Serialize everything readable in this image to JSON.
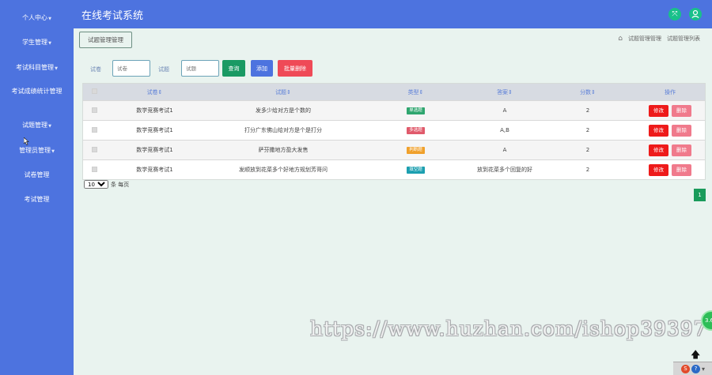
{
  "app": {
    "title": "在线考试系统"
  },
  "sidebar": {
    "items": [
      {
        "label": "个人中心",
        "caret": true
      },
      {
        "label": "学生管理",
        "caret": true
      },
      {
        "label": "考试科目管理",
        "caret": true
      },
      {
        "label": "考试成绩统计管理",
        "caret": false
      },
      {
        "label": "试题管理",
        "caret": true
      },
      {
        "label": "管理员管理",
        "caret": true
      },
      {
        "label": "试卷管理",
        "caret": false
      },
      {
        "label": "考试管理",
        "caret": false
      }
    ]
  },
  "section_button": "试题管理管理",
  "breadcrumb": {
    "home_icon": "home-icon",
    "items": [
      "试题管理管理",
      "试题管理列表"
    ]
  },
  "search": {
    "paper_label": "试卷",
    "paper_placeholder": "试卷",
    "question_label": "试题",
    "question_placeholder": "试题",
    "query_button": "查询",
    "add_button": "添加",
    "batch_delete_button": "批量删除"
  },
  "colors": {
    "query": "#1a9a64",
    "add": "#4d73df",
    "batch_delete": "#ef4a57"
  },
  "table": {
    "columns": [
      "",
      "试卷⇕",
      "试题⇕",
      "类型⇕",
      "答案⇕",
      "分数⇕",
      "操作"
    ],
    "rows": [
      {
        "paper": "数学竞赛考试1",
        "question": "发多少给对方是个数的",
        "type": "单选题",
        "type_color": "#2fa66f",
        "answer": "A",
        "score": "2"
      },
      {
        "paper": "数学竞赛考试1",
        "question": "打分广东佛山给对方是个是打分",
        "type": "多选题",
        "type_color": "#e05a6b",
        "answer": "A,B",
        "score": "2"
      },
      {
        "paper": "数学竞赛考试1",
        "question": "萨芬撒地方盈大发售",
        "type": "判断题",
        "type_color": "#f0a12c",
        "answer": "A",
        "score": "2"
      },
      {
        "paper": "数学竞赛考试1",
        "question": "发顺放到花菜多个好地方规划芳哥问",
        "type": "填空题",
        "type_color": "#1c9fb0",
        "answer": "放到花菜多个回复的好",
        "score": "2"
      }
    ],
    "edit_label": "修改",
    "delete_label": "删除"
  },
  "pagination": {
    "page_size": "10",
    "page_size_options": [
      "10"
    ],
    "page_size_suffix": "条 每页",
    "current_page": "1"
  },
  "watermark": "https://www.huzhan.com/ishop39397"
}
